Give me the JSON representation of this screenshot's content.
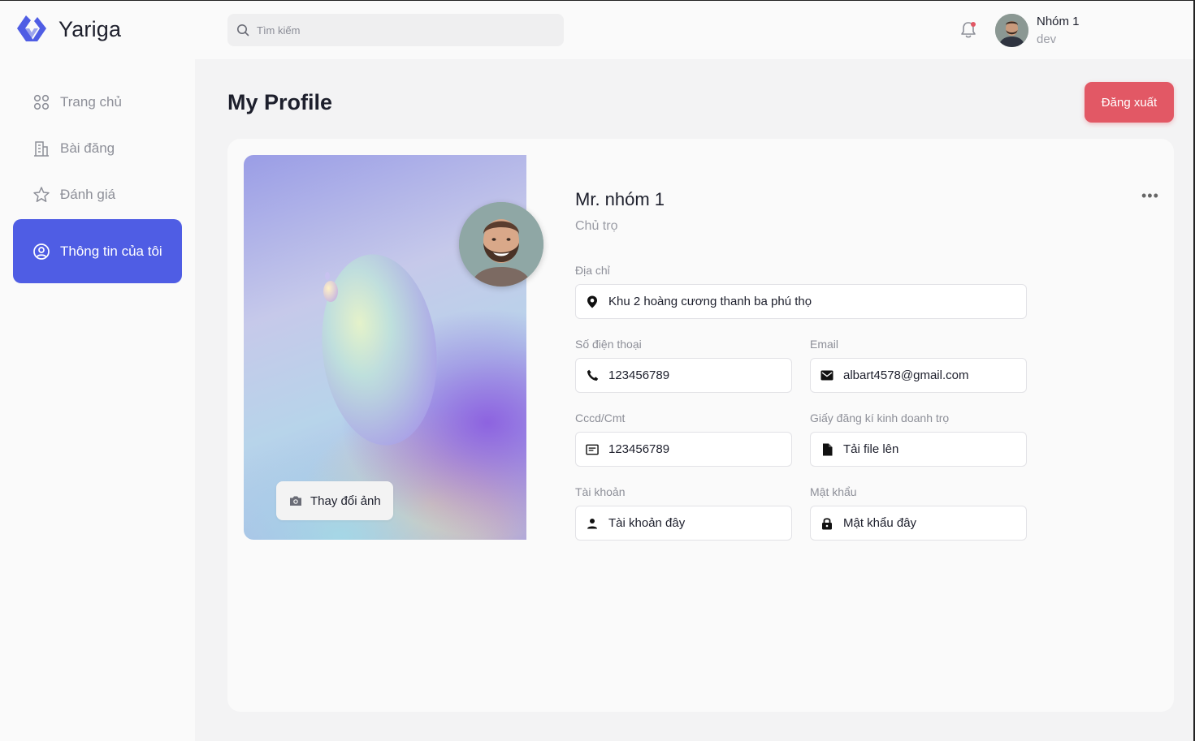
{
  "app": {
    "name": "Yariga"
  },
  "search": {
    "placeholder": "Tìm kiếm"
  },
  "user": {
    "name": "Nhóm 1",
    "role": "dev"
  },
  "sidebar": {
    "items": [
      {
        "label": "Trang chủ",
        "icon": "grid-icon"
      },
      {
        "label": "Bài đăng",
        "icon": "building-icon"
      },
      {
        "label": "Đánh giá",
        "icon": "star-icon"
      },
      {
        "label": "Thông tin của tôi",
        "icon": "user-circle-icon",
        "active": true
      }
    ]
  },
  "page": {
    "title": "My Profile",
    "logout_label": "Đăng xuất"
  },
  "profile": {
    "name": "Mr. nhóm 1",
    "role": "Chủ trọ",
    "change_photo_label": "Thay đổi ảnh",
    "more_label": "•••",
    "fields": {
      "address": {
        "label": "Địa chỉ",
        "value": "Khu 2 hoàng cương thanh ba phú thọ"
      },
      "phone": {
        "label": "Số điện thoại",
        "value": "123456789"
      },
      "email": {
        "label": "Email",
        "value": "albart4578@gmail.com"
      },
      "cccd": {
        "label": "Cccd/Cmt",
        "value": "123456789"
      },
      "license": {
        "label": "Giấy đăng kí kinh doanh trọ",
        "value": "Tải file lên"
      },
      "account": {
        "label": "Tài khoản",
        "value": "Tài khoản đây"
      },
      "password": {
        "label": "Mật khẩu",
        "value": "Mật khẩu đây"
      }
    }
  },
  "colors": {
    "accent": "#4f5de4",
    "logout": "#e25865"
  }
}
